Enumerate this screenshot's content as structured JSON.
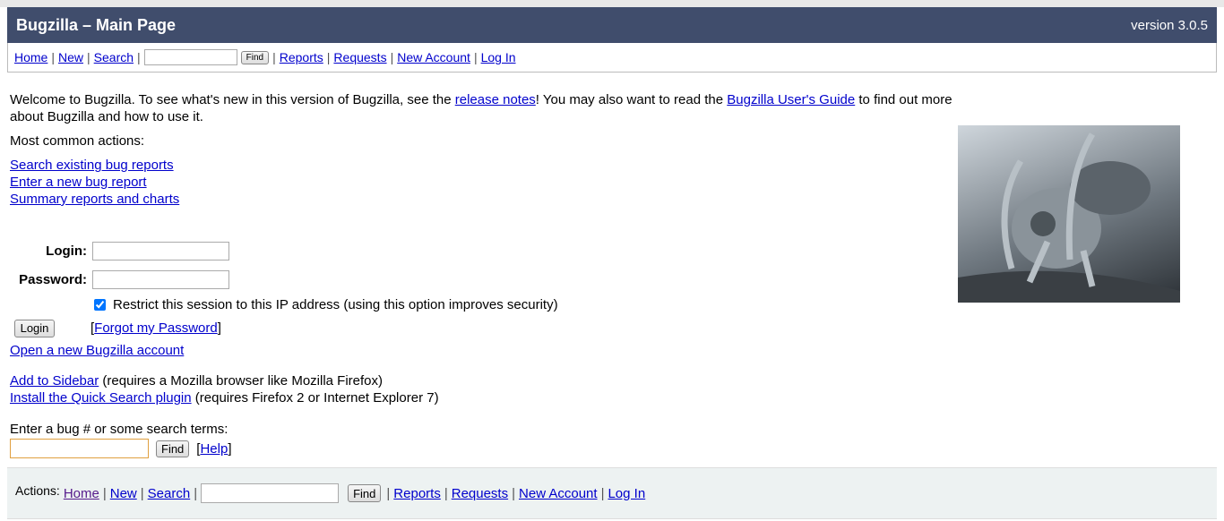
{
  "header": {
    "title": "Bugzilla – Main Page",
    "version": "version 3.0.5"
  },
  "nav": {
    "home": "Home",
    "new": "New",
    "search": "Search",
    "find": "Find",
    "reports": "Reports",
    "requests": "Requests",
    "new_account": "New Account",
    "log_in": "Log In",
    "sep": "|"
  },
  "intro": {
    "t1": "Welcome to Bugzilla. To see what's new in this version of Bugzilla, see the ",
    "release_notes": "release notes",
    "t2": "! You may also want to read the ",
    "guide": "Bugzilla User's Guide",
    "t3": " to find out more about Bugzilla and how to use it."
  },
  "common": {
    "heading": "Most common actions:",
    "links": [
      "Search existing bug reports",
      "Enter a new bug report",
      "Summary reports and charts"
    ]
  },
  "login": {
    "login_label": "Login:",
    "password_label": "Password:",
    "restrict": "Restrict this session to this IP address (using this option improves security)",
    "restrict_checked": true,
    "button": "Login",
    "forgot_open": "[ ",
    "forgot": "Forgot my Password",
    "forgot_close": " ]",
    "open_account": "Open a new Bugzilla account"
  },
  "extras": {
    "sidebar": "Add to Sidebar",
    "sidebar_note": " (requires a Mozilla browser like Mozilla Firefox)",
    "plugin": "Install the Quick Search plugin",
    "plugin_note": " (requires Firefox 2 or Internet Explorer 7)"
  },
  "quicksearch": {
    "label": "Enter a bug # or some search terms:",
    "value": "",
    "find": "Find",
    "help_open": "[",
    "help": "Help",
    "help_close": "]"
  },
  "footer": {
    "actions": "Actions:"
  }
}
